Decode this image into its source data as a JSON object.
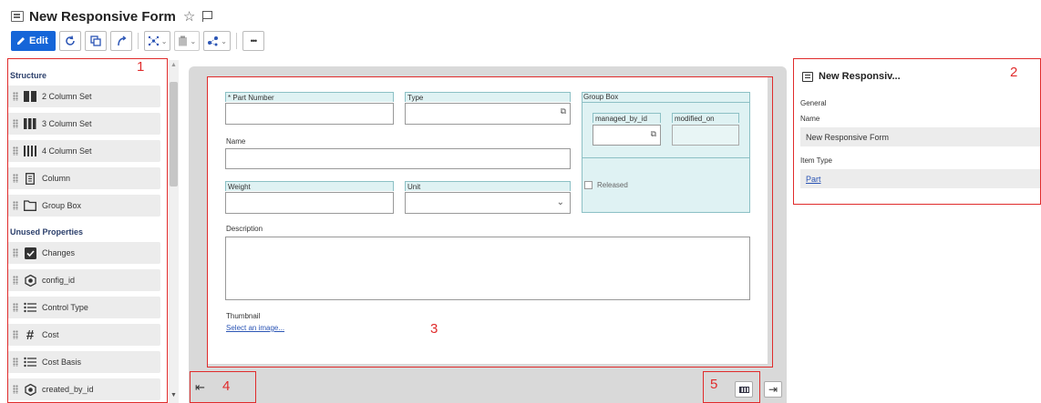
{
  "header": {
    "title": "New Responsive Form",
    "star_glyph": "☆"
  },
  "toolbar": {
    "edit_label": "Edit",
    "more_glyph": "•••"
  },
  "left_panel": {
    "structure_label": "Structure",
    "structure_items": [
      {
        "label": "2 Column Set",
        "icon": "two-column-icon"
      },
      {
        "label": "3 Column Set",
        "icon": "three-column-icon"
      },
      {
        "label": "4 Column Set",
        "icon": "four-column-icon"
      },
      {
        "label": "Column",
        "icon": "column-icon"
      },
      {
        "label": "Group Box",
        "icon": "folder-icon"
      }
    ],
    "unused_label": "Unused Properties",
    "unused_items": [
      {
        "label": "Changes",
        "icon": "checkbox-icon"
      },
      {
        "label": "config_id",
        "icon": "hexagon-icon"
      },
      {
        "label": "Control Type",
        "icon": "list-icon"
      },
      {
        "label": "Cost",
        "icon": "hash-icon"
      },
      {
        "label": "Cost Basis",
        "icon": "list-icon"
      },
      {
        "label": "created_by_id",
        "icon": "hexagon-icon"
      }
    ]
  },
  "form": {
    "part_number_label": "* Part Number",
    "type_label": "Type",
    "group_box_label": "Group Box",
    "managed_by_label": "managed_by_id",
    "modified_on_label": "modified_on",
    "name_label": "Name",
    "weight_label": "Weight",
    "unit_label": "Unit",
    "released_label": "Released",
    "description_label": "Description",
    "thumbnail_label": "Thumbnail",
    "select_image_link": "Select an image..."
  },
  "properties_panel": {
    "title": "New Responsiv...",
    "general_label": "General",
    "name_label": "Name",
    "name_value": "New Responsive Form",
    "item_type_label": "Item Type",
    "item_type_value": "Part"
  },
  "annotations": {
    "n1": "1",
    "n2": "2",
    "n3": "3",
    "n4": "4",
    "n5": "5",
    "color": "#e02b2b"
  },
  "colors": {
    "accent": "#1565d8",
    "link": "#2b55b5",
    "field_label_bg": "#dff2f3"
  }
}
